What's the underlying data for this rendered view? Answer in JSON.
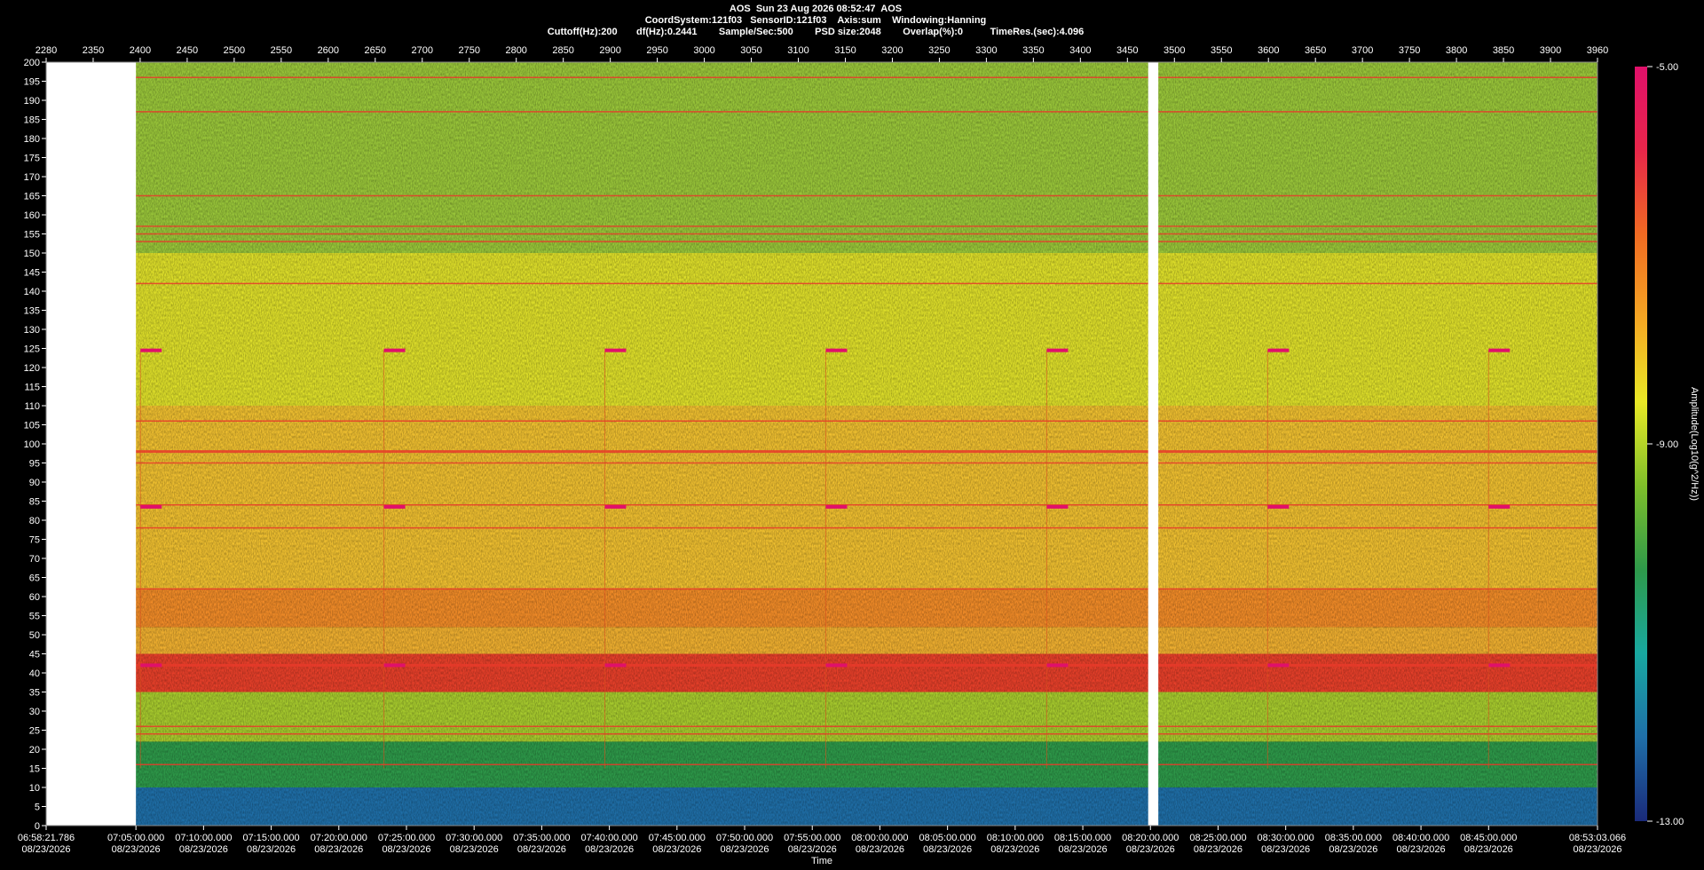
{
  "header": {
    "line1": "AOS  Sun 23 Aug 2026 08:52:47  AOS",
    "line2": "CoordSystem:121f03   SensorID:121f03    Axis:sum    Windowing:Hanning",
    "line3": "Cuttoff(Hz):200       df(Hz):0.2441        Sample/Sec:500        PSD size:2048        Overlap(%):0          TimeRes.(sec):4.096"
  },
  "chart_data": {
    "type": "heatmap",
    "top_axis_ticks": [
      "2280",
      "2350",
      "2400",
      "2450",
      "2500",
      "2550",
      "2600",
      "2650",
      "2700",
      "2750",
      "2800",
      "2850",
      "2900",
      "2950",
      "3000",
      "3050",
      "3100",
      "3150",
      "3200",
      "3250",
      "3300",
      "3350",
      "3400",
      "3450",
      "3500",
      "3550",
      "3600",
      "3650",
      "3700",
      "3750",
      "3800",
      "3850",
      "3900",
      "3960"
    ],
    "y_ticks": [
      "200",
      "195",
      "190",
      "185",
      "180",
      "175",
      "170",
      "165",
      "160",
      "155",
      "150",
      "145",
      "140",
      "135",
      "130",
      "125",
      "120",
      "115",
      "110",
      "105",
      "100",
      "95",
      "90",
      "85",
      "80",
      "75",
      "70",
      "65",
      "60",
      "55",
      "50",
      "45",
      "40",
      "35",
      "30",
      "25",
      "20",
      "15",
      "10",
      "5",
      "0"
    ],
    "ylim": [
      0,
      200
    ],
    "x_ticks": [
      {
        "time": "06:58:21.786",
        "date": "08/23/2026"
      },
      {
        "time": "07:05:00.000",
        "date": "08/23/2026"
      },
      {
        "time": "07:10:00.000",
        "date": "08/23/2026"
      },
      {
        "time": "07:15:00.000",
        "date": "08/23/2026"
      },
      {
        "time": "07:20:00.000",
        "date": "08/23/2026"
      },
      {
        "time": "07:25:00.000",
        "date": "08/23/2026"
      },
      {
        "time": "07:30:00.000",
        "date": "08/23/2026"
      },
      {
        "time": "07:35:00.000",
        "date": "08/23/2026"
      },
      {
        "time": "07:40:00.000",
        "date": "08/23/2026"
      },
      {
        "time": "07:45:00.000",
        "date": "08/23/2026"
      },
      {
        "time": "07:50:00.000",
        "date": "08/23/2026"
      },
      {
        "time": "07:55:00.000",
        "date": "08/23/2026"
      },
      {
        "time": "08:00:00.000",
        "date": "08/23/2026"
      },
      {
        "time": "08:05:00.000",
        "date": "08/23/2026"
      },
      {
        "time": "08:10:00.000",
        "date": "08/23/2026"
      },
      {
        "time": "08:15:00.000",
        "date": "08/23/2026"
      },
      {
        "time": "08:20:00.000",
        "date": "08/23/2026"
      },
      {
        "time": "08:25:00.000",
        "date": "08/23/2026"
      },
      {
        "time": "08:30:00.000",
        "date": "08/23/2026"
      },
      {
        "time": "08:35:00.000",
        "date": "08/23/2026"
      },
      {
        "time": "08:40:00.000",
        "date": "08/23/2026"
      },
      {
        "time": "08:45:00.000",
        "date": "08/23/2026"
      },
      {
        "time": "08:53:03.066",
        "date": "08/23/2026"
      }
    ],
    "xlabel": "Time",
    "colorbar": {
      "label": "Amplitude(Log10(g^2/Hz))",
      "max": "-5.00",
      "mid": "-9.00",
      "min": "-13.00",
      "colors": [
        "#1a2a7a",
        "#1f6fa8",
        "#18a8a0",
        "#2e9a4a",
        "#7fbf2a",
        "#e9e926",
        "#f5a623",
        "#f06a22",
        "#e8264a",
        "#e0106a"
      ]
    },
    "data_gaps": [
      {
        "from": "06:58:21.786",
        "to": "07:05:00.000"
      },
      {
        "from": "08:19:50.000",
        "to": "08:20:35.000"
      }
    ],
    "persistent_lines_hz": [
      196,
      187,
      165,
      157,
      155,
      153,
      142,
      106,
      98,
      95,
      84,
      78,
      62,
      42,
      26,
      24,
      16
    ],
    "bands": [
      {
        "from_hz": 0,
        "to_hz": 10,
        "level": "low",
        "color": "#1f6fa8"
      },
      {
        "from_hz": 10,
        "to_hz": 22,
        "level": "low-mid",
        "color": "#2e9a4a"
      },
      {
        "from_hz": 22,
        "to_hz": 35,
        "level": "mid",
        "color": "#a8cc2e"
      },
      {
        "from_hz": 35,
        "to_hz": 45,
        "level": "high",
        "color": "#e8402a"
      },
      {
        "from_hz": 45,
        "to_hz": 52,
        "level": "mid-high",
        "color": "#f0b030"
      },
      {
        "from_hz": 52,
        "to_hz": 62,
        "level": "high",
        "color": "#f28c28"
      },
      {
        "from_hz": 62,
        "to_hz": 110,
        "level": "mid-high",
        "color": "#f0c030"
      },
      {
        "from_hz": 110,
        "to_hz": 150,
        "level": "mid",
        "color": "#dfe02a"
      },
      {
        "from_hz": 150,
        "to_hz": 200,
        "level": "low-mid",
        "color": "#9ac73a"
      }
    ],
    "events": [
      "07:05:20",
      "07:23:20",
      "07:39:40",
      "07:56:00",
      "08:12:20",
      "08:28:40",
      "08:45:00"
    ],
    "event_marker_hz": [
      124.5,
      83.5,
      42
    ]
  }
}
